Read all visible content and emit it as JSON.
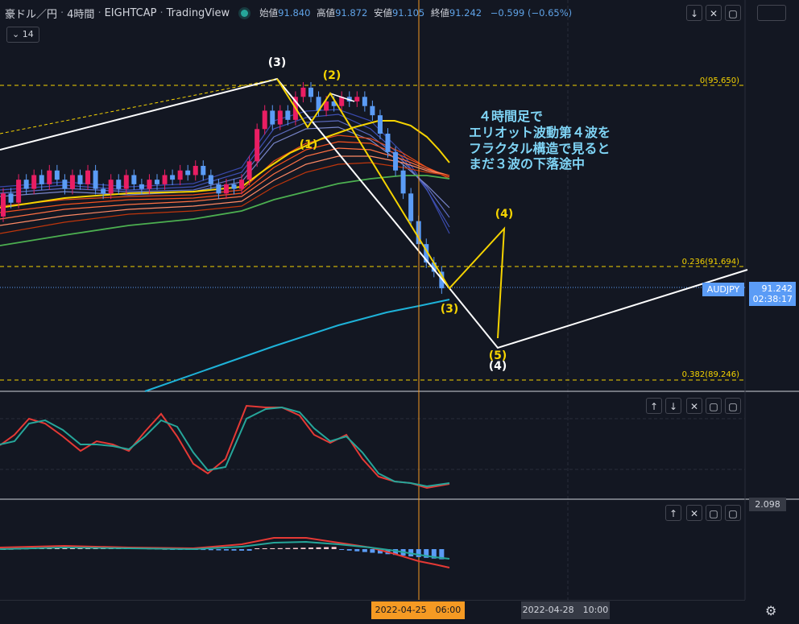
{
  "header": {
    "symbol_name": "豪ドル／円",
    "interval": "4時間",
    "exchange": "EIGHTCAP",
    "source": "TradingView",
    "open_label": "始値",
    "open_value": "91.840",
    "high_label": "高値",
    "high_value": "91.872",
    "low_label": "安値",
    "low_value": "91.105",
    "close_label": "終値",
    "close_value": "91.242",
    "change": "−0.599 (−0.65%)"
  },
  "indicator_badge": "14",
  "price_tag": {
    "symbol": "AUDJPY",
    "price": "91.242",
    "countdown": "02:38:17"
  },
  "oscillator_value": "2.098",
  "time_axis": {
    "cursor_label": "2022-04-25　06:00",
    "marker_label": "2022-04-28　10:00"
  },
  "fib_levels": [
    {
      "label": "0(95.650)",
      "price": 95.65
    },
    {
      "label": "0.236(91.694)",
      "price": 91.694
    },
    {
      "label": "0.382(89.246)",
      "price": 89.246
    }
  ],
  "annotation": {
    "lines": [
      "４時間足で",
      "エリオット波動第４波を",
      "フラクタル構造で見ると",
      "まだ３波の下落途中"
    ]
  },
  "wave_labels": [
    {
      "text": "(3)",
      "color": "#ffffff"
    },
    {
      "text": "(2)",
      "color": "#f5d300"
    },
    {
      "text": "(1)",
      "color": "#f5d300"
    },
    {
      "text": "(4)",
      "color": "#f5d300"
    },
    {
      "text": "(3)",
      "color": "#f5d300"
    },
    {
      "text": "(5)",
      "color": "#f5d300"
    },
    {
      "text": "(4)",
      "color": "#ffffff"
    }
  ],
  "colors": {
    "background": "#131722",
    "up": "#e91e63",
    "down": "#5b9cf6",
    "wave_white": "#ffffff",
    "wave_yellow": "#f5d300",
    "fib": "#f5d300",
    "ma_cyan": "#1eb2d8",
    "ma_green": "#4caf50",
    "osc_red": "#e53935",
    "osc_teal": "#26a69a"
  },
  "chart_data": {
    "type": "candlestick",
    "symbol": "AUDJPY",
    "timeframe": "4h",
    "ylim": [
      88.7,
      96.6
    ],
    "last_price": 91.242,
    "candles": [
      {
        "o": 92.8,
        "c": 93.3
      },
      {
        "o": 93.3,
        "c": 93.1
      },
      {
        "o": 93.1,
        "c": 93.6
      },
      {
        "o": 93.6,
        "c": 93.4
      },
      {
        "o": 93.4,
        "c": 93.7
      },
      {
        "o": 93.7,
        "c": 93.5
      },
      {
        "o": 93.5,
        "c": 93.8
      },
      {
        "o": 93.8,
        "c": 93.6
      },
      {
        "o": 93.6,
        "c": 93.4
      },
      {
        "o": 93.4,
        "c": 93.7
      },
      {
        "o": 93.7,
        "c": 93.5
      },
      {
        "o": 93.5,
        "c": 93.8
      },
      {
        "o": 93.8,
        "c": 93.4
      },
      {
        "o": 93.4,
        "c": 93.3
      },
      {
        "o": 93.3,
        "c": 93.6
      },
      {
        "o": 93.6,
        "c": 93.4
      },
      {
        "o": 93.4,
        "c": 93.7
      },
      {
        "o": 93.7,
        "c": 93.5
      },
      {
        "o": 93.5,
        "c": 93.4
      },
      {
        "o": 93.4,
        "c": 93.6
      },
      {
        "o": 93.6,
        "c": 93.5
      },
      {
        "o": 93.5,
        "c": 93.7
      },
      {
        "o": 93.7,
        "c": 93.6
      },
      {
        "o": 93.6,
        "c": 93.8
      },
      {
        "o": 93.8,
        "c": 93.7
      },
      {
        "o": 93.7,
        "c": 93.9
      },
      {
        "o": 93.9,
        "c": 93.7
      },
      {
        "o": 93.7,
        "c": 93.5
      },
      {
        "o": 93.5,
        "c": 93.3
      },
      {
        "o": 93.3,
        "c": 93.5
      },
      {
        "o": 93.5,
        "c": 93.4
      },
      {
        "o": 93.4,
        "c": 93.6
      },
      {
        "o": 93.6,
        "c": 94.0
      },
      {
        "o": 94.0,
        "c": 94.7
      },
      {
        "o": 94.7,
        "c": 95.1
      },
      {
        "o": 95.1,
        "c": 94.8
      },
      {
        "o": 94.8,
        "c": 95.1
      },
      {
        "o": 95.1,
        "c": 94.9
      },
      {
        "o": 94.9,
        "c": 95.4
      },
      {
        "o": 95.4,
        "c": 95.6
      },
      {
        "o": 95.6,
        "c": 95.4
      },
      {
        "o": 95.4,
        "c": 95.1
      },
      {
        "o": 95.1,
        "c": 95.3
      },
      {
        "o": 95.3,
        "c": 95.2
      },
      {
        "o": 95.2,
        "c": 95.4
      },
      {
        "o": 95.4,
        "c": 95.3
      },
      {
        "o": 95.3,
        "c": 95.4
      },
      {
        "o": 95.4,
        "c": 95.2
      },
      {
        "o": 95.2,
        "c": 95.0
      },
      {
        "o": 95.0,
        "c": 94.6
      },
      {
        "o": 94.6,
        "c": 94.2
      },
      {
        "o": 94.2,
        "c": 93.8
      },
      {
        "o": 93.8,
        "c": 93.3
      },
      {
        "o": 93.3,
        "c": 92.7
      },
      {
        "o": 92.7,
        "c": 92.2
      },
      {
        "o": 92.2,
        "c": 91.8
      },
      {
        "o": 91.8,
        "c": 91.6
      },
      {
        "o": 91.6,
        "c": 91.24
      }
    ],
    "series": [
      {
        "name": "MA fast",
        "values": [
          92.7,
          92.9,
          93.1,
          93.4,
          93.6
        ]
      },
      {
        "name": "MA slow",
        "values": [
          91.5,
          91.9,
          92.3,
          92.8,
          93.3
        ]
      }
    ]
  }
}
